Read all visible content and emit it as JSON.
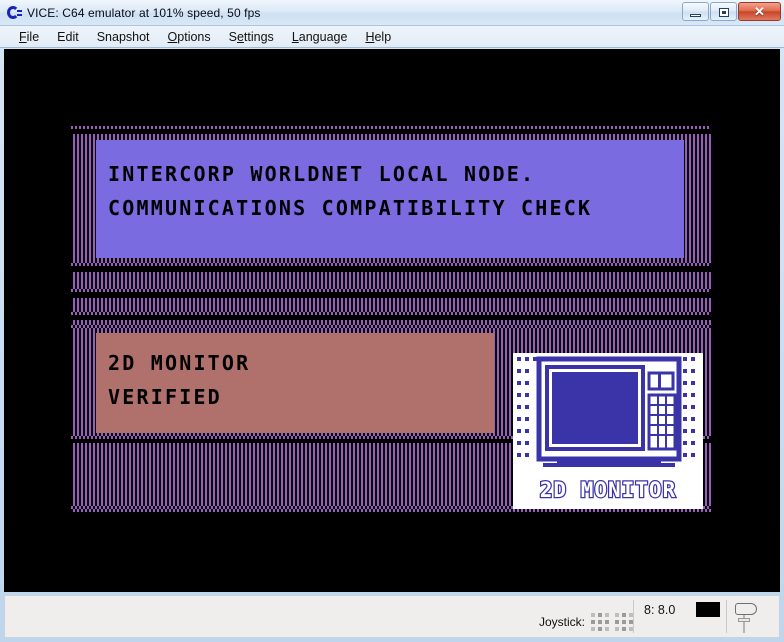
{
  "window": {
    "title": "VICE: C64 emulator at 101% speed, 50 fps",
    "icon": "c64-logo-icon",
    "controls": {
      "minimize": "minimize-button",
      "maximize": "maximize-button",
      "close_glyph": "✕"
    }
  },
  "menubar": {
    "items": [
      {
        "label": "File",
        "accel": "F"
      },
      {
        "label": "Edit",
        "accel": "E"
      },
      {
        "label": "Snapshot",
        "accel": "S"
      },
      {
        "label": "Options",
        "accel": "O"
      },
      {
        "label": "Settings",
        "accel": "e"
      },
      {
        "label": "Language",
        "accel": "L"
      },
      {
        "label": "Help",
        "accel": "H"
      }
    ]
  },
  "screen": {
    "background_color": "#000000",
    "stripe_color": "#9b5cc0",
    "top_panel": {
      "background_color": "#7a6ce0",
      "lines": [
        "INTERCORP WORLDNET LOCAL NODE.",
        "COMMUNICATIONS COMPATIBILITY CHECK"
      ]
    },
    "status_panel": {
      "background_color": "#b0706b",
      "lines": [
        "2D MONITOR",
        "VERIFIED"
      ]
    },
    "icon_tile": {
      "caption": "2D MONITOR",
      "tile_color": "#ffffff",
      "art_color": "#3a34a8"
    }
  },
  "statusbar": {
    "joystick_label": "Joystick:",
    "drive_status": "8: 8.0",
    "led_color": "#000000",
    "tape_icon": "tape-icon"
  }
}
